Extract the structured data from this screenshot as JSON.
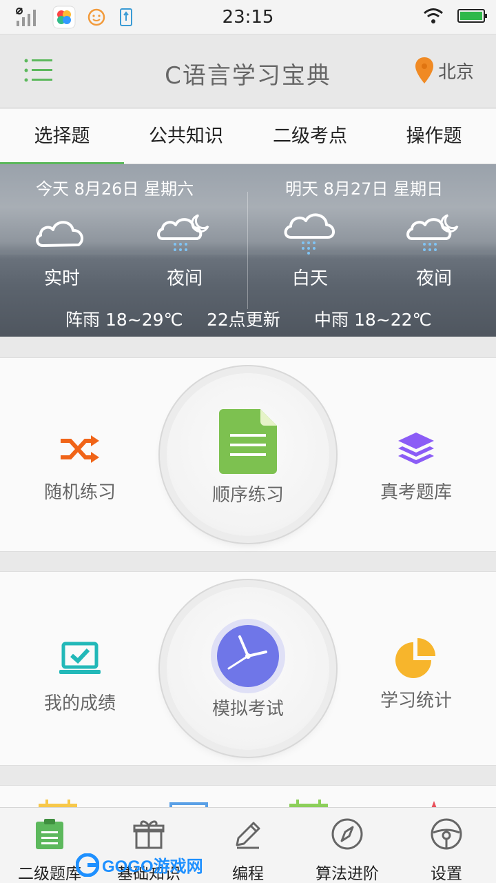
{
  "status_bar": {
    "time": "23:15"
  },
  "header": {
    "title": "C语言学习宝典",
    "location": "北京"
  },
  "tabs": [
    {
      "label": "选择题",
      "active": true
    },
    {
      "label": "公共知识"
    },
    {
      "label": "二级考点"
    },
    {
      "label": "操作题"
    }
  ],
  "weather": {
    "today": {
      "date": "今天 8月26日 星期六",
      "slot1": "实时",
      "slot2": "夜间",
      "summary": "阵雨 18~29℃"
    },
    "update": "22点更新",
    "tomorrow": {
      "date": "明天 8月27日 星期日",
      "slot1": "白天",
      "slot2": "夜间",
      "summary": "中雨 18~22℃"
    }
  },
  "practice": {
    "left": {
      "label": "随机练习",
      "icon": "shuffle-icon",
      "color": "#f06418"
    },
    "center": {
      "label": "顺序练习",
      "icon": "document-icon",
      "color": "#7dc150"
    },
    "right": {
      "label": "真考题库",
      "icon": "layers-icon",
      "color": "#8b5cf6"
    }
  },
  "exam": {
    "left": {
      "label": "我的成绩",
      "icon": "laptop-check-icon",
      "color": "#22b8b8"
    },
    "center": {
      "label": "模拟考试",
      "icon": "clock-icon",
      "color": "#6f76e8"
    },
    "right": {
      "label": "学习统计",
      "icon": "pie-chart-icon",
      "color": "#f7b52c"
    }
  },
  "bottom_nav": [
    {
      "label": "二级题库",
      "icon": "notepad-icon",
      "active": true
    },
    {
      "label": "基础知识",
      "icon": "gift-icon"
    },
    {
      "label": "编程",
      "icon": "pencil-icon"
    },
    {
      "label": "算法进阶",
      "icon": "compass-icon"
    },
    {
      "label": "设置",
      "icon": "steering-wheel-icon"
    }
  ],
  "watermark": {
    "text": "GOGO游戏网"
  },
  "colors": {
    "accent": "#5cb85c",
    "location_pin": "#f08a24"
  }
}
